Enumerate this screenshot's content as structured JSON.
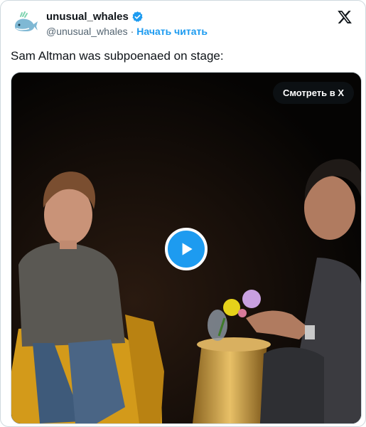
{
  "author": {
    "display_name": "unusual_whales",
    "handle": "@unusual_whales",
    "separator": "·",
    "follow_label": "Начать читать",
    "avatar_icon": "whale-icon",
    "verified_icon": "verified-badge-icon"
  },
  "tweet": {
    "text": "Sam Altman was subpoenaed on stage:"
  },
  "media": {
    "watch_label": "Смотреть в X",
    "play_icon": "play-icon"
  },
  "colors": {
    "accent": "#1d9bf0",
    "text": "#0f1419",
    "muted": "#536471",
    "border": "#cfd9de"
  }
}
